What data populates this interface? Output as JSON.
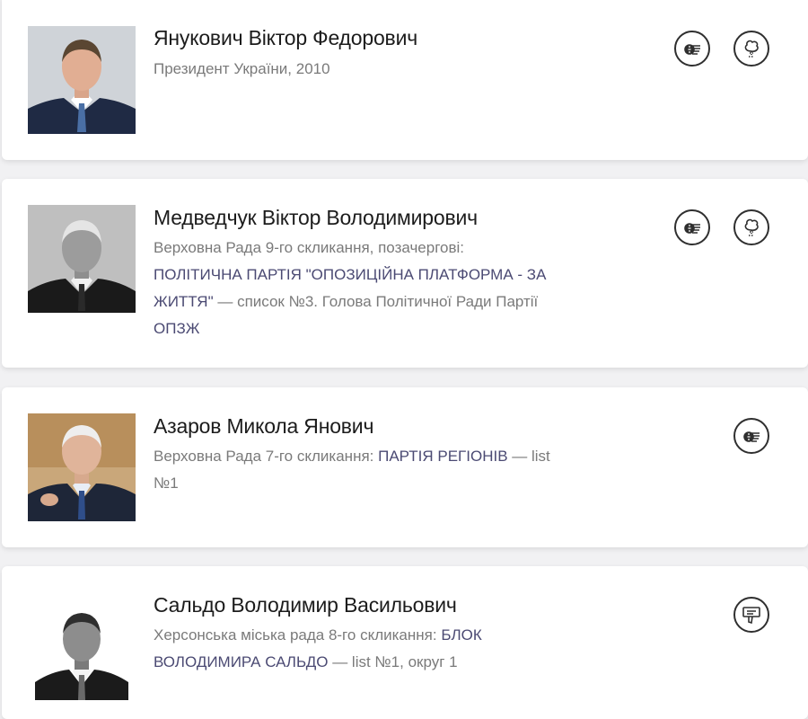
{
  "people": [
    {
      "name": "Янукович Віктор Федорович",
      "desc_plain": "Президент України, 2010",
      "icons": [
        "money-hand-icon",
        "tree-icon"
      ]
    },
    {
      "name": "Медведчук Віктор Володимирович",
      "desc_prefix": "Верховна Рада 9-го скликання, позачергові:",
      "party_link": "ПОЛІТИЧНА ПАРТІЯ \"ОПОЗИЦІЙНА ПЛАТФОРМА - ЗА ЖИТТЯ\"",
      "desc_suffix": " — список №3. Голова Політичної Ради Партії ",
      "extra_link": "ОПЗЖ",
      "icons": [
        "money-hand-icon",
        "tree-icon"
      ]
    },
    {
      "name": "Азаров Микола Янович",
      "desc_prefix": "Верховна Рада 7-го скликання:",
      "party_link": "ПАРТІЯ РЕГІОНІВ",
      "desc_suffix": " — list №1",
      "icons": [
        "money-hand-icon"
      ]
    },
    {
      "name": "Сальдо Володимир Васильович",
      "desc_prefix": "Херсонська міська рада 8-го скликання:",
      "party_link": "БЛОК ВОЛОДИМИРА САЛЬДО",
      "desc_suffix": " — list №1, округ 1",
      "icons": [
        "thumbs-down-icon"
      ]
    }
  ]
}
